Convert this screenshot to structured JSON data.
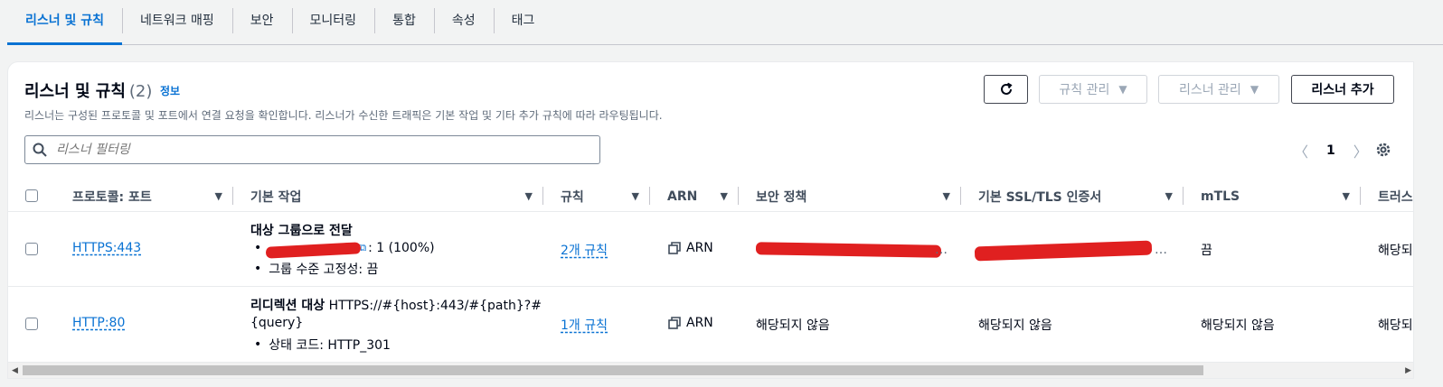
{
  "tabs": [
    {
      "label": "리스너 및 규칙",
      "active": true
    },
    {
      "label": "네트워크 매핑"
    },
    {
      "label": "보안"
    },
    {
      "label": "모니터링"
    },
    {
      "label": "통합"
    },
    {
      "label": "속성"
    },
    {
      "label": "태그"
    }
  ],
  "section": {
    "title": "리스너 및 규칙",
    "count": "(2)",
    "info": "정보",
    "description": "리스너는 구성된 프로토콜 및 포트에서 연결 요청을 확인합니다. 리스너가 수신한 트래픽은 기본 작업 및 기타 추가 규칙에 따라 라우팅됩니다."
  },
  "buttons": {
    "rules_mgmt": "규칙 관리",
    "listener_mgmt": "리스너 관리",
    "add_listener": "리스너 추가"
  },
  "search": {
    "placeholder": "리스너 필터링"
  },
  "pager": {
    "page": "1"
  },
  "columns": [
    "프로토콜: 포트",
    "기본 작업",
    "규칙",
    "ARN",
    "보안 정책",
    "기본 SSL/TLS 인증서",
    "mTLS",
    "트러스"
  ],
  "rows": [
    {
      "protocol": "HTTPS:443",
      "action_title": "대상 그룹으로 전달",
      "action_target_suffix": ": 1 (100%)",
      "action_detail": "그룹 수준 고정성: 끔",
      "rules": "2개 규칙",
      "arn": "ARN",
      "security_policy": "",
      "certificate": "",
      "mtls": "끔",
      "trust": "해당되"
    },
    {
      "protocol": "HTTP:80",
      "action_title": "리디렉션 대상",
      "action_url": "HTTPS://#{host}:443/#{path}?#",
      "action_url2": "{query}",
      "action_detail": "상태 코드: HTTP_301",
      "rules": "1개 규칙",
      "arn": "ARN",
      "security_policy": "해당되지 않음",
      "certificate": "해당되지 않음",
      "mtls": "해당되지 않음",
      "trust": "해당되"
    }
  ],
  "icons": [
    "search-icon",
    "refresh-icon",
    "caret-down-icon",
    "chevron-left-icon",
    "chevron-right-icon",
    "gear-icon",
    "copy-icon",
    "sort-icon",
    "external-link-icon"
  ],
  "colors": {
    "link": "#0972d3",
    "redaction": "#e02020",
    "border": "#7d8998"
  }
}
